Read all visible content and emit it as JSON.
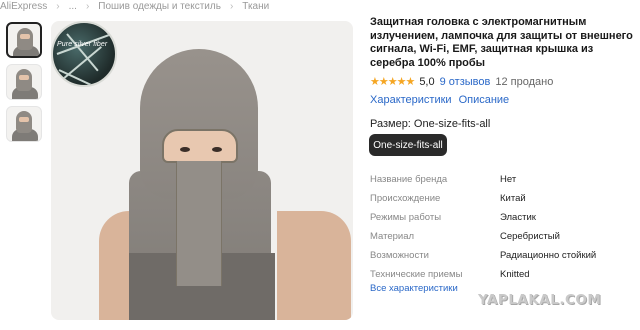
{
  "breadcrumb": [
    "AliExpress",
    "...",
    "Пошив одежды и текстиль",
    "Ткани"
  ],
  "badge_text": "Pure silver fiber",
  "product": {
    "title": "Защитная головка с электромагнитным излучением, лампочка для защиты от внешнего сигнала, Wi-Fi, EMF, защитная крышка из серебра 100% пробы",
    "stars": "★★★★★",
    "score": "5,0",
    "reviews": "9 отзывов",
    "sold": "12 продано",
    "tabs": [
      "Характеристики",
      "Описание"
    ]
  },
  "size": {
    "label": "Размер: One-size-fits-all",
    "option": "One-size-fits-all"
  },
  "specs": [
    {
      "key": "Название бренда",
      "value": "Нет"
    },
    {
      "key": "Происхождение",
      "value": "Китай"
    },
    {
      "key": "Режимы работы",
      "value": "Эластик"
    },
    {
      "key": "Материал",
      "value": "Серебристый"
    },
    {
      "key": "Возможности",
      "value": "Радиационно стойкий"
    },
    {
      "key": "Технические приемы",
      "value": "Knitted"
    }
  ],
  "all_specs_link": "Все характеристики",
  "watermark": "YAPLAKAL.COM",
  "colors": {
    "link": "#2a68c8",
    "star": "#f5a623",
    "selected_size_bg": "#2a2a2a"
  }
}
